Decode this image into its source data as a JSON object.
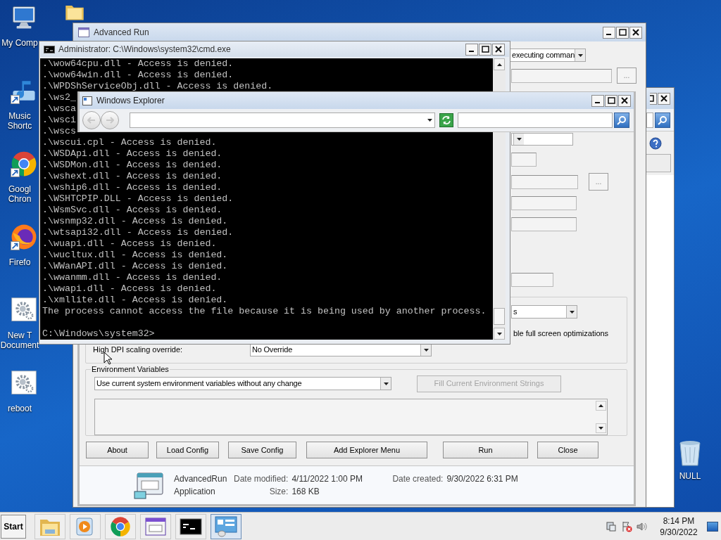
{
  "desktop": {
    "left_icons": [
      {
        "kind": "computer",
        "shortcut": false,
        "lines": [
          "My Comp"
        ]
      },
      {
        "kind": "music",
        "shortcut": true,
        "lines": [
          "Music",
          "Shortc"
        ]
      },
      {
        "kind": "browser",
        "shortcut": true,
        "lines": [
          "Googl",
          "Chron"
        ]
      },
      {
        "kind": "fox",
        "shortcut": true,
        "lines": [
          "Firefo"
        ]
      },
      {
        "kind": "gear",
        "shortcut": false,
        "lines": [
          "New T",
          "Document"
        ]
      },
      {
        "kind": "gear",
        "shortcut": false,
        "lines": [
          "reboot"
        ]
      }
    ],
    "other_icons": [
      {
        "kind": "folder"
      },
      {
        "kind": "trash",
        "lines": [
          "NULL"
        ]
      }
    ]
  },
  "advanced_run": {
    "title": "Advanced Run",
    "command_combo": "executing comman",
    "field_buttons": [
      "...",
      "..."
    ],
    "priority_combo": "s",
    "fullscreen_label": "ble full screen optimizations",
    "dpi_label": "High DPI scaling override:",
    "dpi_combo": "No Override",
    "env_group": "Environment Variables",
    "env_combo": "Use current system environment variables without any change",
    "fill_button": {
      "label": "Fill Current Environment Strings",
      "disabled": true
    },
    "buttons": [
      "About",
      "Load Config",
      "Save Config",
      "Add Explorer Menu",
      "Run",
      "Close"
    ]
  },
  "cmd": {
    "title": "Administrator: C:\\Windows\\system32\\cmd.exe",
    "lines": [
      ".\\wow64cpu.dll - Access is denied.",
      ".\\wow64win.dll - Access is denied.",
      ".\\WPDShServiceObj.dll - Access is denied.",
      ".\\ws2_",
      ".\\wsca",
      ".\\wsci",
      ".\\wscs",
      ".\\wscui.cpl - Access is denied.",
      ".\\WSDApi.dll - Access is denied.",
      ".\\WSDMon.dll - Access is denied.",
      ".\\wshext.dll - Access is denied.",
      ".\\wship6.dll - Access is denied.",
      ".\\WSHTCPIP.DLL - Access is denied.",
      ".\\WsmSvc.dll - Access is denied.",
      ".\\wsnmp32.dll - Access is denied.",
      ".\\wtsapi32.dll - Access is denied.",
      ".\\wuapi.dll - Access is denied.",
      ".\\wucltux.dll - Access is denied.",
      ".\\WWanAPI.dll - Access is denied.",
      ".\\wwanmm.dll - Access is denied.",
      ".\\wwapi.dll - Access is denied.",
      ".\\xmllite.dll - Access is denied.",
      "The process cannot access the file because it is being used by another process."
    ],
    "prompt": "C:\\Windows\\system32>"
  },
  "explorer": {
    "title": "Windows Explorer",
    "details": [
      {
        "text": "AdvancedRun",
        "fields": [
          {
            "label": "Date modified:",
            "value": "4/11/2022 1:00 PM"
          },
          {
            "label": "Date created:",
            "value": "9/30/2022 6:31 PM"
          }
        ]
      },
      {
        "text": "Application",
        "fields": [
          {
            "label": "Size:",
            "value": "168 KB"
          }
        ]
      }
    ]
  },
  "taskbar": {
    "start": "Start",
    "apps": [
      {
        "kind": "folder",
        "selected": false
      },
      {
        "kind": "media",
        "selected": false
      },
      {
        "kind": "browser",
        "selected": false
      },
      {
        "kind": "app",
        "selected": false
      },
      {
        "kind": "console",
        "selected": false
      },
      {
        "kind": "panel",
        "selected": true
      }
    ],
    "time": "8:14 PM",
    "date": "9/30/2022"
  }
}
